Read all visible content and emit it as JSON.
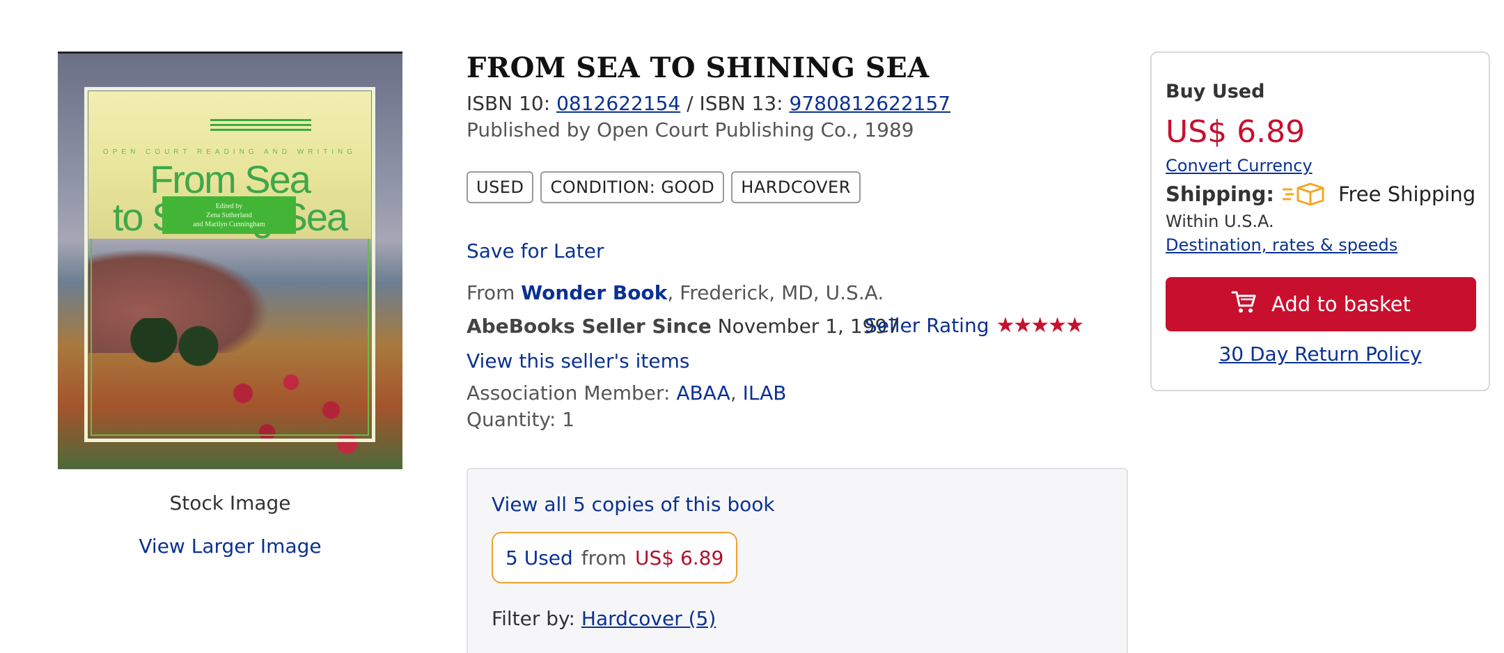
{
  "book": {
    "title": "FROM SEA TO SHINING SEA",
    "isbn10_label": "ISBN 10:",
    "isbn10": "0812622154",
    "isbn_sep": "/ ISBN 13:",
    "isbn13": "9780812622157",
    "published": "Published by Open Court Publishing Co., 1989",
    "badges": [
      "USED",
      "CONDITION: GOOD",
      "HARDCOVER"
    ]
  },
  "cover": {
    "series": "OPEN COURT READING AND WRITING",
    "title_line1": "From Sea",
    "title_line2": "to Shining Sea",
    "editors_line1": "Edited by",
    "editors_line2": "Zena Sutherland",
    "editors_line3": "and Marilyn Cunningham",
    "stock_label": "Stock Image",
    "larger_link": "View Larger Image"
  },
  "seller": {
    "save_later": "Save for Later",
    "from_prefix": "From",
    "name": "Wonder Book",
    "location": ", Frederick, MD, U.S.A.",
    "since_label": "AbeBooks Seller Since",
    "since_date": "November 1, 1997",
    "rating_label": "Seller Rating",
    "rating_stars": 5,
    "stars_text": "★★★★★",
    "view_items": "View this seller's items",
    "assoc_label": "Association Member:",
    "assoc1": "ABAA",
    "assoc_sep": ",",
    "assoc2": "ILAB",
    "quantity": "Quantity: 1"
  },
  "copies": {
    "view_all": "View all 5 copies of this book",
    "used_count": "5 Used",
    "from": "from",
    "price": "US$ 6.89",
    "filter_label": "Filter by:",
    "filter_value": "Hardcover (5)"
  },
  "buybox": {
    "heading": "Buy Used",
    "price": "US$ 6.89",
    "convert": "Convert Currency",
    "shipping_label": "Shipping:",
    "shipping_value": "Free Shipping",
    "within": "Within U.S.A.",
    "destination": "Destination, rates & speeds",
    "add_button": "Add to basket",
    "return_policy": "30 Day Return Policy",
    "icons": [
      "truck-icon",
      "cart-icon"
    ],
    "accent_color": "#c8102e",
    "link_color": "#0a3192"
  }
}
